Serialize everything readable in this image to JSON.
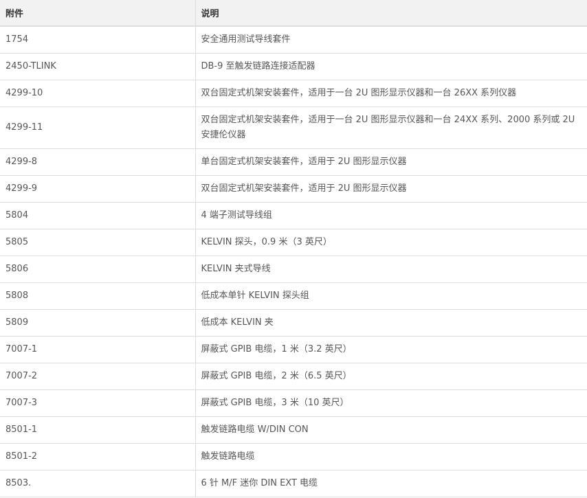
{
  "table": {
    "headers": [
      "附件",
      "说明"
    ],
    "rows": [
      [
        "1754",
        "安全通用测试导线套件"
      ],
      [
        "2450-TLINK",
        "DB-9 至触发链路连接适配器"
      ],
      [
        "4299-10",
        "双台固定式机架安装套件，适用于一台 2U 图形显示仪器和一台 26XX 系列仪器"
      ],
      [
        "4299-11",
        "双台固定式机架安装套件，适用于一台 2U 图形显示仪器和一台 24XX 系列、2000 系列或 2U 安捷伦仪器"
      ],
      [
        "4299-8",
        "单台固定式机架安装套件，适用于 2U 图形显示仪器"
      ],
      [
        "4299-9",
        "双台固定式机架安装套件，适用于 2U 图形显示仪器"
      ],
      [
        "5804",
        "4 端子测试导线组"
      ],
      [
        "5805",
        "KELVIN 探头，0.9 米（3 英尺）"
      ],
      [
        "5806",
        "KELVIN 夹式导线"
      ],
      [
        "5808",
        "低成本单针 KELVIN 探头组"
      ],
      [
        "5809",
        "低成本 KELVIN 夹"
      ],
      [
        "7007-1",
        "屏蔽式 GPIB 电缆，1 米（3.2 英尺）"
      ],
      [
        "7007-2",
        "屏蔽式 GPIB 电缆，2 米（6.5 英尺）"
      ],
      [
        "7007-3",
        "屏蔽式 GPIB 电缆，3 米（10 英尺）"
      ],
      [
        "8501-1",
        "触发链路电缆 W/DIN CON"
      ],
      [
        "8501-2",
        "触发链路电缆"
      ],
      [
        "8503.",
        "6 针 M/F 迷你 DIN EXT 电缆"
      ]
    ]
  }
}
